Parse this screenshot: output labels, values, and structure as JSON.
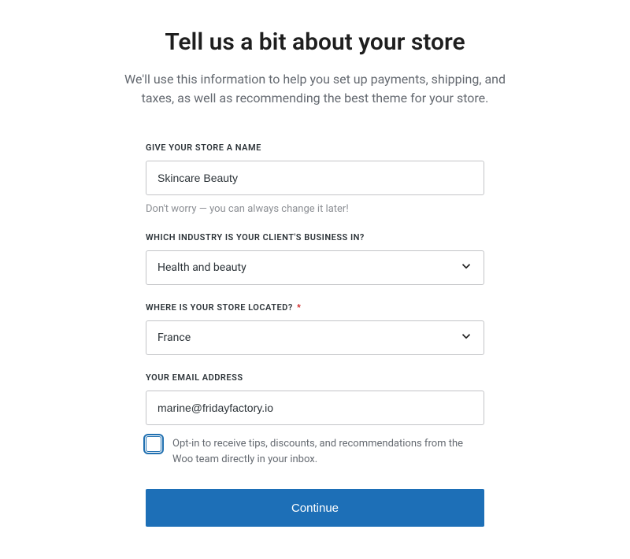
{
  "heading": "Tell us a bit about your store",
  "subtitle": "We'll use this information to help you set up payments, shipping, and taxes, as well as recommending the best theme for your store.",
  "form": {
    "store_name": {
      "label": "GIVE YOUR STORE A NAME",
      "value": "Skincare Beauty",
      "helper": "Don't worry — you can always change it later!"
    },
    "industry": {
      "label": "WHICH INDUSTRY IS YOUR CLIENT'S BUSINESS IN?",
      "value": "Health and beauty"
    },
    "location": {
      "label": "WHERE IS YOUR STORE LOCATED?",
      "required_mark": "*",
      "value": "France"
    },
    "email": {
      "label": "YOUR EMAIL ADDRESS",
      "value": "marine@fridayfactory.io"
    },
    "optin": {
      "label": "Opt-in to receive tips, discounts, and recommendations from the Woo team directly in your inbox.",
      "checked": false
    },
    "continue_label": "Continue"
  }
}
